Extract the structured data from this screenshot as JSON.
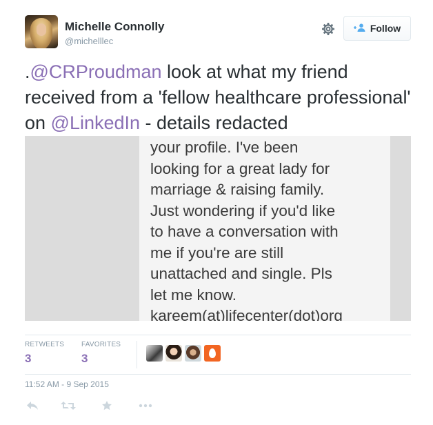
{
  "user": {
    "name": "Michelle Connolly",
    "handle": "@michelllec"
  },
  "follow_button": {
    "label": "Follow",
    "icon": "add-person-icon"
  },
  "tweet": {
    "prefix": ".",
    "mention1": "@CRProudman",
    "text1": " look at what my friend received from a 'fellow healthcare professional' on ",
    "mention2": "@LinkedIn",
    "text2": " - details redacted"
  },
  "media": {
    "text": "your profile. I've been\nlooking for a great lady for\nmarriage & raising family.\nJust wondering if you'd like\nto have a conversation with\nme if you're are still\nunattached and single. Pls\nlet me know.\nkareem(at)lifecenter(dot)org"
  },
  "stats": {
    "retweets_label": "RETWEETS",
    "retweets_count": "3",
    "favorites_label": "FAVORITES",
    "favorites_count": "3"
  },
  "timestamp": "11:52 AM - 9 Sep 2015",
  "actions": [
    "reply-icon",
    "retweet-icon",
    "favorite-icon",
    "more-icon"
  ],
  "colors": {
    "link": "#8a6fb5",
    "muted": "#8899a6",
    "text": "#292f33",
    "follow_icon": "#55acee"
  }
}
